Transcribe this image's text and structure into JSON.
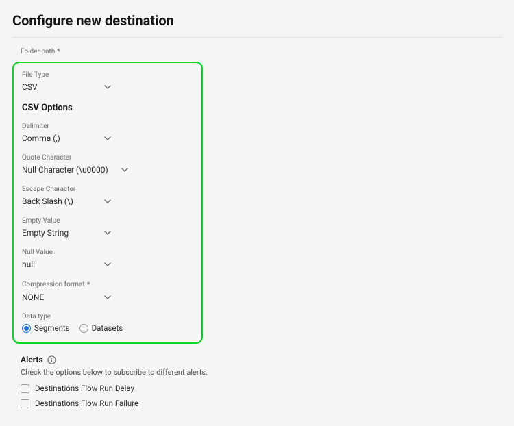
{
  "page_title": "Configure new destination",
  "folder_path_label": "Folder path",
  "form": {
    "file_type": {
      "label": "File Type",
      "value": "CSV"
    },
    "csv_options_title": "CSV Options",
    "delimiter": {
      "label": "Delimiter",
      "value": "Comma (,)"
    },
    "quote_character": {
      "label": "Quote Character",
      "value": "Null Character (\\u0000)"
    },
    "escape_character": {
      "label": "Escape Character",
      "value": "Back Slash (\\)"
    },
    "empty_value": {
      "label": "Empty Value",
      "value": "Empty String"
    },
    "null_value": {
      "label": "Null Value",
      "value": "null"
    },
    "compression_format": {
      "label": "Compression format",
      "value": "NONE"
    },
    "data_type": {
      "label": "Data type",
      "options": {
        "segments": "Segments",
        "datasets": "Datasets"
      },
      "selected": "segments"
    }
  },
  "alerts": {
    "title": "Alerts",
    "description": "Check the options below to subscribe to different alerts.",
    "items": [
      "Destinations Flow Run Delay",
      "Destinations Flow Run Failure"
    ]
  }
}
